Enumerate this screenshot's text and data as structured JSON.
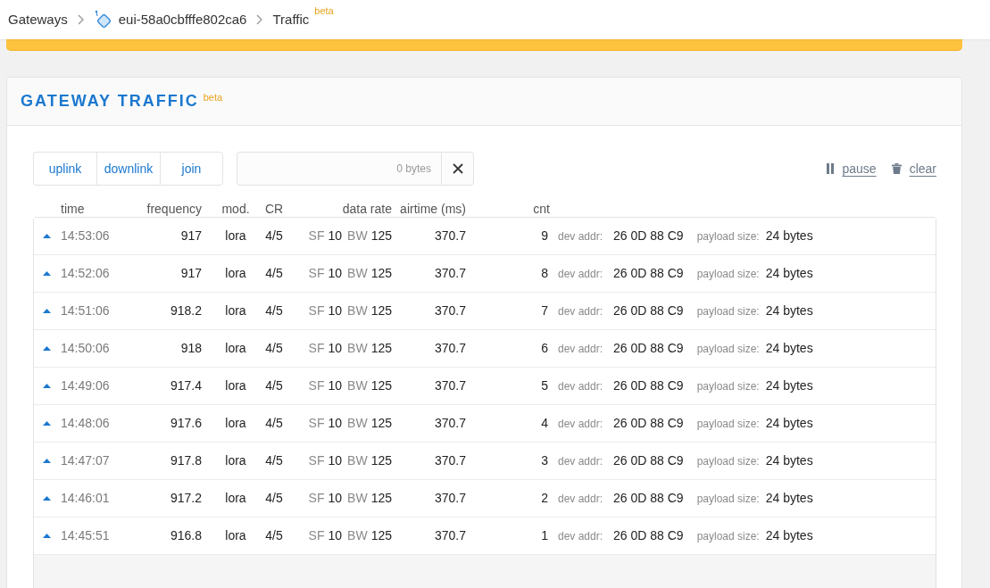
{
  "breadcrumb": [
    {
      "kind": "link",
      "label": "Gateways"
    },
    {
      "kind": "gateway",
      "label": "eui-58a0cbfffe802ca6"
    },
    {
      "kind": "page",
      "label": "Traffic",
      "badge": "beta"
    }
  ],
  "panel": {
    "title": "GATEWAY TRAFFIC",
    "badge": "beta"
  },
  "filters": [
    {
      "label": "uplink",
      "selected": false
    },
    {
      "label": "downlink",
      "selected": false
    },
    {
      "label": "join",
      "selected": false
    }
  ],
  "payload_filter": {
    "placeholder": "0 bytes"
  },
  "actions": [
    {
      "kind": "pause",
      "label": "pause"
    },
    {
      "kind": "clear",
      "label": "clear"
    }
  ],
  "table": {
    "columns": [
      "time",
      "frequency",
      "mod.",
      "CR",
      "data rate",
      "airtime (ms)",
      "cnt"
    ],
    "rows": [
      {
        "kind": "uplink",
        "time": "14:53:06",
        "frequency": "917",
        "modulation": "lora",
        "cr": "4/5",
        "sf_label": "SF",
        "sf": "10",
        "bw_label": "BW",
        "bw": "125",
        "airtime": "370.7",
        "cnt": "9",
        "dev_addr_label": "dev addr:",
        "dev_addr": "26 0D 88 C9",
        "payload_label": "payload size:",
        "payload_size": "24 bytes"
      },
      {
        "kind": "uplink",
        "time": "14:52:06",
        "frequency": "917",
        "modulation": "lora",
        "cr": "4/5",
        "sf_label": "SF",
        "sf": "10",
        "bw_label": "BW",
        "bw": "125",
        "airtime": "370.7",
        "cnt": "8",
        "dev_addr_label": "dev addr:",
        "dev_addr": "26 0D 88 C9",
        "payload_label": "payload size:",
        "payload_size": "24 bytes"
      },
      {
        "kind": "uplink",
        "time": "14:51:06",
        "frequency": "918.2",
        "modulation": "lora",
        "cr": "4/5",
        "sf_label": "SF",
        "sf": "10",
        "bw_label": "BW",
        "bw": "125",
        "airtime": "370.7",
        "cnt": "7",
        "dev_addr_label": "dev addr:",
        "dev_addr": "26 0D 88 C9",
        "payload_label": "payload size:",
        "payload_size": "24 bytes"
      },
      {
        "kind": "uplink",
        "time": "14:50:06",
        "frequency": "918",
        "modulation": "lora",
        "cr": "4/5",
        "sf_label": "SF",
        "sf": "10",
        "bw_label": "BW",
        "bw": "125",
        "airtime": "370.7",
        "cnt": "6",
        "dev_addr_label": "dev addr:",
        "dev_addr": "26 0D 88 C9",
        "payload_label": "payload size:",
        "payload_size": "24 bytes"
      },
      {
        "kind": "uplink",
        "time": "14:49:06",
        "frequency": "917.4",
        "modulation": "lora",
        "cr": "4/5",
        "sf_label": "SF",
        "sf": "10",
        "bw_label": "BW",
        "bw": "125",
        "airtime": "370.7",
        "cnt": "5",
        "dev_addr_label": "dev addr:",
        "dev_addr": "26 0D 88 C9",
        "payload_label": "payload size:",
        "payload_size": "24 bytes"
      },
      {
        "kind": "uplink",
        "time": "14:48:06",
        "frequency": "917.6",
        "modulation": "lora",
        "cr": "4/5",
        "sf_label": "SF",
        "sf": "10",
        "bw_label": "BW",
        "bw": "125",
        "airtime": "370.7",
        "cnt": "4",
        "dev_addr_label": "dev addr:",
        "dev_addr": "26 0D 88 C9",
        "payload_label": "payload size:",
        "payload_size": "24 bytes"
      },
      {
        "kind": "uplink",
        "time": "14:47:07",
        "frequency": "917.8",
        "modulation": "lora",
        "cr": "4/5",
        "sf_label": "SF",
        "sf": "10",
        "bw_label": "BW",
        "bw": "125",
        "airtime": "370.7",
        "cnt": "3",
        "dev_addr_label": "dev addr:",
        "dev_addr": "26 0D 88 C9",
        "payload_label": "payload size:",
        "payload_size": "24 bytes"
      },
      {
        "kind": "uplink",
        "time": "14:46:01",
        "frequency": "917.2",
        "modulation": "lora",
        "cr": "4/5",
        "sf_label": "SF",
        "sf": "10",
        "bw_label": "BW",
        "bw": "125",
        "airtime": "370.7",
        "cnt": "2",
        "dev_addr_label": "dev addr:",
        "dev_addr": "26 0D 88 C9",
        "payload_label": "payload size:",
        "payload_size": "24 bytes"
      },
      {
        "kind": "uplink",
        "time": "14:45:51",
        "frequency": "916.8",
        "modulation": "lora",
        "cr": "4/5",
        "sf_label": "SF",
        "sf": "10",
        "bw_label": "BW",
        "bw": "125",
        "airtime": "370.7",
        "cnt": "1",
        "dev_addr_label": "dev addr:",
        "dev_addr": "26 0D 88 C9",
        "payload_label": "payload size:",
        "payload_size": "24 bytes"
      }
    ]
  }
}
